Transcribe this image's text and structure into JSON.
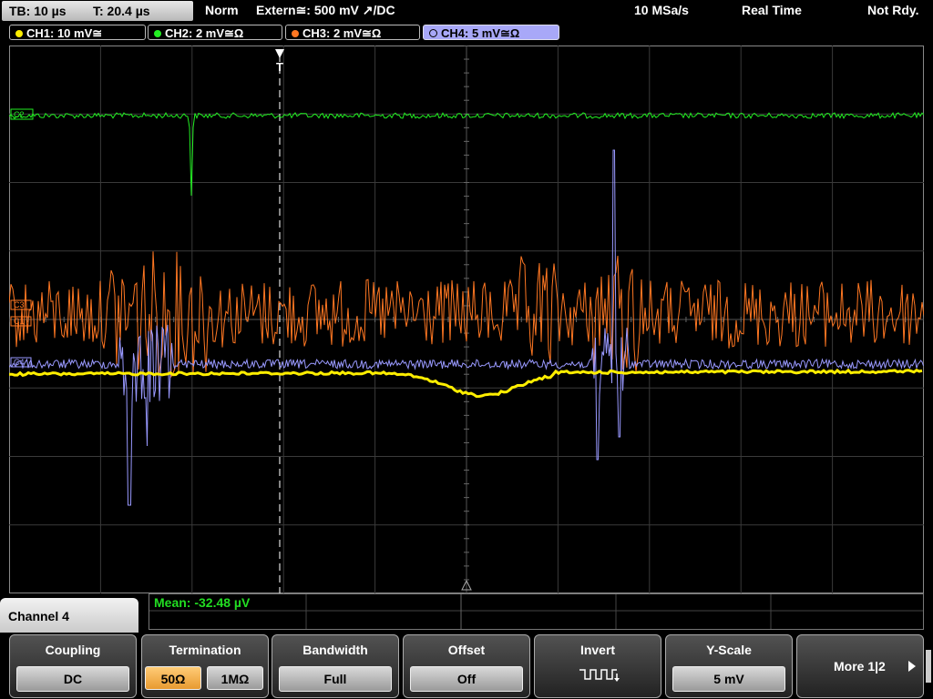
{
  "top_bar": {
    "timebase": "TB: 10 µs",
    "trigger_time": "T: 20.4 µs",
    "mode": "Norm",
    "trigger_source": "Extern≅: 500 mV ↗/DC",
    "sample_rate": "10 MSa/s",
    "acq_mode": "Real Time",
    "status": "Not Rdy."
  },
  "channels": [
    {
      "label": "CH1: 10 mV≅",
      "color": "#ffee00",
      "active": false
    },
    {
      "label": "CH2: 2 mV≅Ω",
      "color": "#22ee22",
      "active": false
    },
    {
      "label": "CH3: 2 mV≅Ω",
      "color": "#ff7722",
      "active": false
    },
    {
      "label": "CH4: 5 mV≅Ω",
      "color": "#9999ff",
      "active": true
    }
  ],
  "waveform_markers": {
    "ch1": "C1",
    "ch2": "C2",
    "ch3": "C3",
    "ch4": "C4",
    "trigger": "T"
  },
  "measurement": {
    "mean": "Mean: -32.48 µV"
  },
  "menu": {
    "title": "Channel 4",
    "coupling": {
      "title": "Coupling",
      "value": "DC"
    },
    "termination": {
      "title": "Termination",
      "options": [
        "50Ω",
        "1MΩ"
      ],
      "selected": "50Ω"
    },
    "bandwidth": {
      "title": "Bandwidth",
      "value": "Full"
    },
    "offset": {
      "title": "Offset",
      "value": "Off"
    },
    "invert": {
      "title": "Invert"
    },
    "yscale": {
      "title": "Y-Scale",
      "value": "5 mV"
    },
    "more": {
      "label": "More 1|2"
    }
  }
}
